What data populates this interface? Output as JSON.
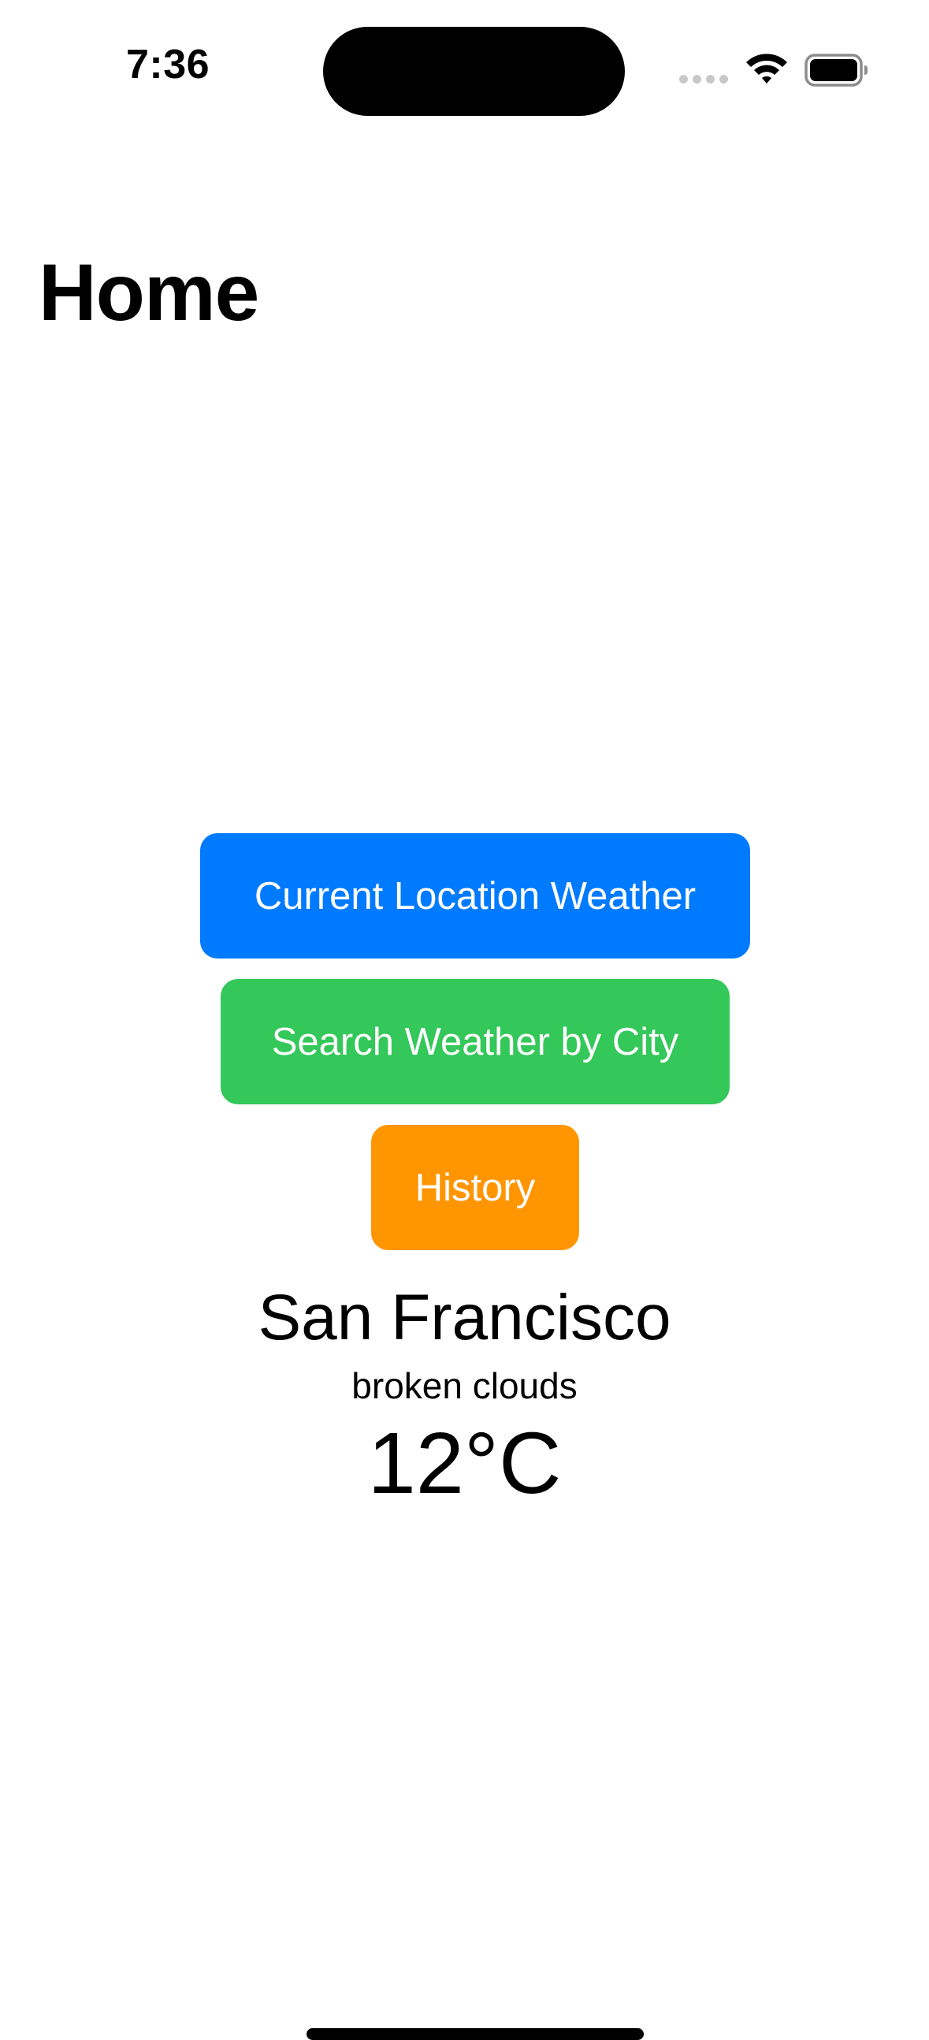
{
  "status_bar": {
    "time": "7:36",
    "icons": [
      "cellular-signal-icon",
      "wifi-icon",
      "battery-icon"
    ]
  },
  "header": {
    "title": "Home"
  },
  "buttons": {
    "current_location": "Current Location Weather",
    "search_city": "Search Weather by City",
    "history": "History"
  },
  "weather": {
    "city": "San Francisco",
    "description": "broken clouds",
    "temperature": "12°C"
  },
  "colors": {
    "current_location_button": "#007AFF",
    "search_city_button": "#34C759",
    "history_button": "#FF9500",
    "background": "#FFFFFF",
    "text": "#000000"
  }
}
